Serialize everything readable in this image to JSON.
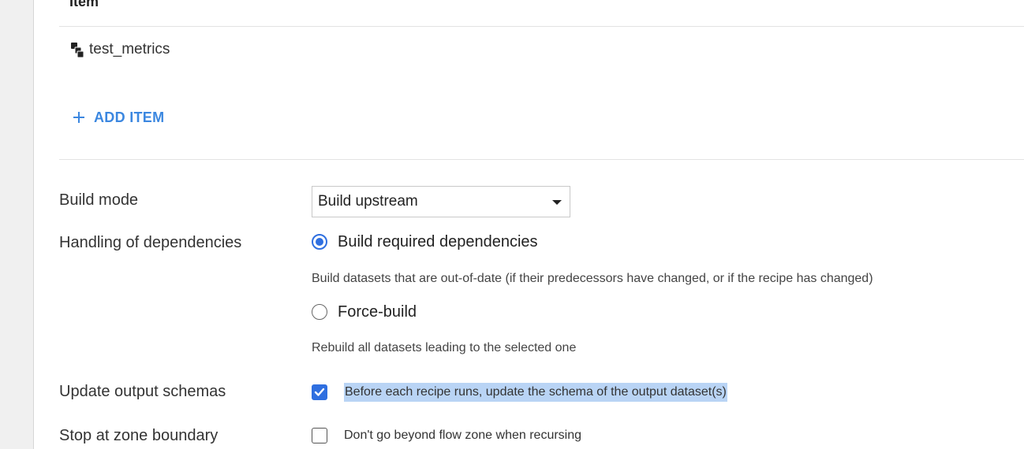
{
  "items_table": {
    "header": "Item",
    "items": [
      {
        "label": "test_metrics",
        "icon": "cubes-icon"
      }
    ],
    "add_button_label": "ADD ITEM"
  },
  "form": {
    "build_mode": {
      "label": "Build mode",
      "selected": "Build upstream"
    },
    "dependencies": {
      "label": "Handling of dependencies",
      "options": [
        {
          "label": "Build required dependencies",
          "help": "Build datasets that are out-of-date (if their predecessors have changed, or if the recipe has changed)",
          "checked": true
        },
        {
          "label": "Force-build",
          "help": "Rebuild all datasets leading to the selected one",
          "checked": false
        }
      ]
    },
    "update_schemas": {
      "label": "Update output schemas",
      "checkbox_label": "Before each recipe runs, update the schema of the output dataset(s)",
      "checked": true
    },
    "zone_boundary": {
      "label": "Stop at zone boundary",
      "checkbox_label": "Don't go beyond flow zone when recursing",
      "checked": false
    }
  },
  "colors": {
    "accent": "#3b87e0",
    "control_blue": "#2f6fe0",
    "selection_highlight": "#b9d4f5"
  }
}
